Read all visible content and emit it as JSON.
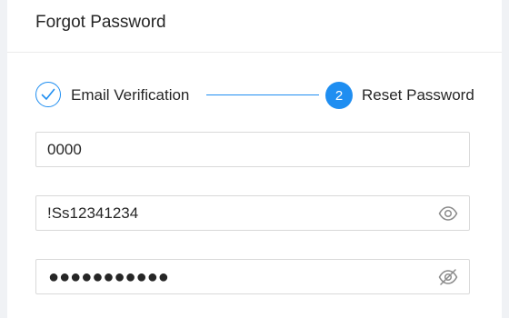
{
  "card": {
    "title": "Forgot Password"
  },
  "steps": [
    {
      "label": "Email Verification",
      "status": "done",
      "icon": "check-icon"
    },
    {
      "label": "Reset Password",
      "status": "active",
      "number": "2"
    }
  ],
  "form": {
    "verification_code": {
      "value": "0000"
    },
    "new_password": {
      "value": "!Ss12341234",
      "visible": true,
      "icon": "eye-icon"
    },
    "confirm_password": {
      "value": "●●●●●●●●●●●",
      "visible": false,
      "icon": "eye-slash-icon"
    }
  },
  "colors": {
    "accent": "#1f8ef1",
    "border": "#d9d9d9",
    "text": "#262626",
    "icon": "#8c8c8c"
  }
}
